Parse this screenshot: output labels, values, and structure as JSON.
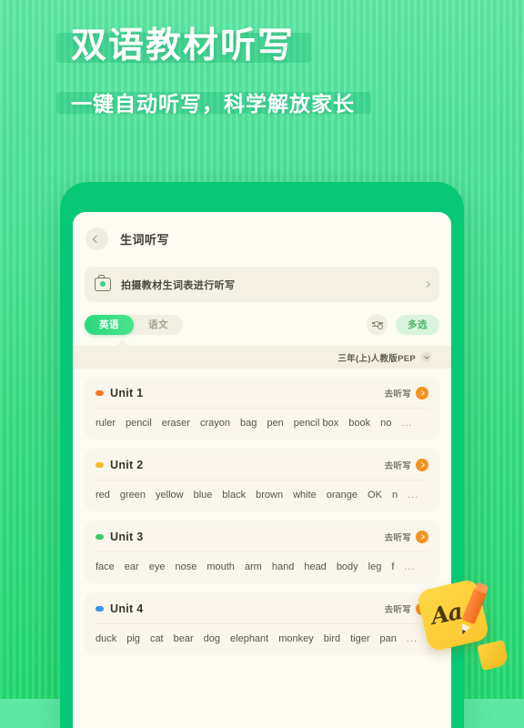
{
  "promo": {
    "headline": "双语教材听写",
    "subline": "一键自动听写，科学解放家长"
  },
  "colors": {
    "bg_top": "#5ee8a6",
    "bg_bottom": "#23da6f",
    "phone_body": "#07c876",
    "screen": "#fdfcf2",
    "card": "#faf6ec",
    "accent_green": "#2bd97c",
    "accent_orange": "#f59220"
  },
  "app": {
    "nav": {
      "back_icon": "chevron-left-icon",
      "title": "生词听写"
    },
    "camera_row": {
      "icon": "camera-icon",
      "label": "拍摄教材生词表进行听写",
      "chevron": "chevron-right-icon"
    },
    "tabs": [
      {
        "label": "英语",
        "active": true
      },
      {
        "label": "语文",
        "active": false
      }
    ],
    "filter_icon": "sliders-icon",
    "multi_select_label": "多选",
    "book_selector": {
      "label": "三年(上)人教版PEP",
      "chevron": "chevron-down-icon"
    },
    "go_label": "去听写",
    "go_icon": "arrow-right-circle-icon",
    "units": [
      {
        "name": "Unit 1",
        "dot_color": "#f5762a",
        "words": [
          "ruler",
          "pencil",
          "eraser",
          "crayon",
          "bag",
          "pen",
          "pencil box",
          "book",
          "no"
        ],
        "overflow": "..."
      },
      {
        "name": "Unit 2",
        "dot_color": "#f5bc2a",
        "words": [
          "red",
          "green",
          "yellow",
          "blue",
          "black",
          "brown",
          "white",
          "orange",
          "OK",
          "n"
        ],
        "overflow": "..."
      },
      {
        "name": "Unit 3",
        "dot_color": "#3ec96a",
        "words": [
          "face",
          "ear",
          "eye",
          "nose",
          "mouth",
          "arm",
          "hand",
          "head",
          "body",
          "leg",
          "f"
        ],
        "overflow": "..."
      },
      {
        "name": "Unit 4",
        "dot_color": "#3a92f0",
        "words": [
          "duck",
          "pig",
          "cat",
          "bear",
          "dog",
          "elephant",
          "monkey",
          "bird",
          "tiger",
          "pan"
        ],
        "overflow": "..."
      }
    ]
  },
  "sticker": {
    "text": "Aa",
    "pencil_icon": "pencil-icon"
  }
}
